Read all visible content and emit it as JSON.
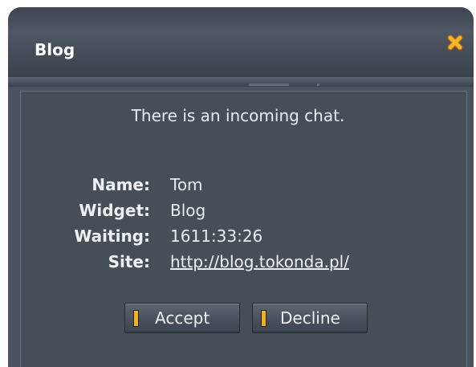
{
  "window": {
    "title": "Blog",
    "accent_color": "#f2a91a",
    "close_icon": "close-x-icon"
  },
  "message": "There is an incoming chat.",
  "details": {
    "name_label": "Name:",
    "name_value": "Tom",
    "widget_label": "Widget:",
    "widget_value": "Blog",
    "waiting_label": "Waiting:",
    "waiting_value": "1611:33:26",
    "site_label": "Site:",
    "site_value": "http://blog.tokonda.pl/"
  },
  "buttons": {
    "accept_label": "Accept",
    "decline_label": "Decline"
  }
}
